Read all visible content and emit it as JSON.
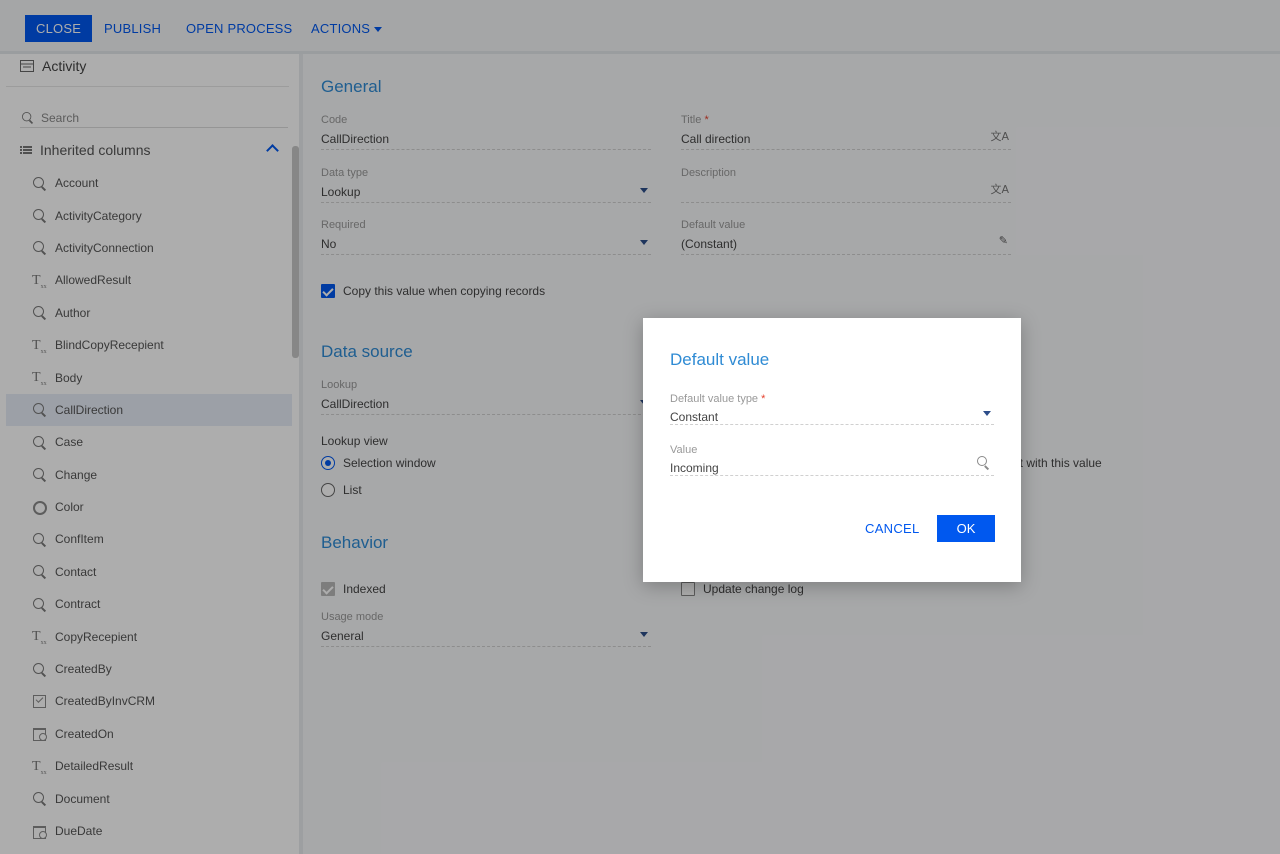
{
  "toolbar": {
    "close_label": "CLOSE",
    "publish_label": "PUBLISH",
    "open_process_label": "OPEN PROCESS",
    "actions_label": "ACTIONS"
  },
  "sidebar": {
    "header": "Activity",
    "search_placeholder": "Search",
    "group_title": "Inherited columns",
    "items": [
      {
        "label": "Account",
        "icon": "lookup-icon"
      },
      {
        "label": "ActivityCategory",
        "icon": "lookup-icon"
      },
      {
        "label": "ActivityConnection",
        "icon": "lookup-icon"
      },
      {
        "label": "AllowedResult",
        "icon": "text-icon"
      },
      {
        "label": "Author",
        "icon": "lookup-icon"
      },
      {
        "label": "BlindCopyRecepient",
        "icon": "text-icon"
      },
      {
        "label": "Body",
        "icon": "text-icon"
      },
      {
        "label": "CallDirection",
        "icon": "lookup-icon",
        "selected": true
      },
      {
        "label": "Case",
        "icon": "lookup-icon"
      },
      {
        "label": "Change",
        "icon": "lookup-icon"
      },
      {
        "label": "Color",
        "icon": "color-icon"
      },
      {
        "label": "ConfItem",
        "icon": "lookup-icon"
      },
      {
        "label": "Contact",
        "icon": "lookup-icon"
      },
      {
        "label": "Contract",
        "icon": "lookup-icon"
      },
      {
        "label": "CopyRecepient",
        "icon": "text-icon"
      },
      {
        "label": "CreatedBy",
        "icon": "lookup-icon"
      },
      {
        "label": "CreatedByInvCRM",
        "icon": "checkbox-icon"
      },
      {
        "label": "CreatedOn",
        "icon": "datetime-icon"
      },
      {
        "label": "DetailedResult",
        "icon": "text-icon"
      },
      {
        "label": "Document",
        "icon": "lookup-icon"
      },
      {
        "label": "DueDate",
        "icon": "datetime-icon"
      }
    ]
  },
  "general": {
    "title": "General",
    "code_label": "Code",
    "code_value": "CallDirection",
    "title_label": "Title",
    "title_value": "Call direction",
    "data_type_label": "Data type",
    "data_type_value": "Lookup",
    "description_label": "Description",
    "description_value": "",
    "required_label": "Required",
    "required_value": "No",
    "default_value_label": "Default value",
    "default_value_value": "(Constant)",
    "copy_checkbox_label": "Copy this value when copying records"
  },
  "data_source": {
    "title": "Data source",
    "lookup_label": "Lookup",
    "lookup_value": "CallDirection",
    "lookup_view_label": "Lookup view",
    "option_selection_window": "Selection window",
    "option_list": "List",
    "partial_text": "ect with this value"
  },
  "behavior": {
    "title": "Behavior",
    "indexed_label": "Indexed",
    "update_change_log_label": "Update change log",
    "usage_mode_label": "Usage mode",
    "usage_mode_value": "General"
  },
  "modal": {
    "title": "Default value",
    "type_label": "Default value type",
    "type_value": "Constant",
    "value_label": "Value",
    "value_value": "Incoming",
    "cancel_label": "CANCEL",
    "ok_label": "OK"
  },
  "colors": {
    "accent": "#0058ef",
    "section_title": "#2f8bd4",
    "required": "#e5412d"
  }
}
